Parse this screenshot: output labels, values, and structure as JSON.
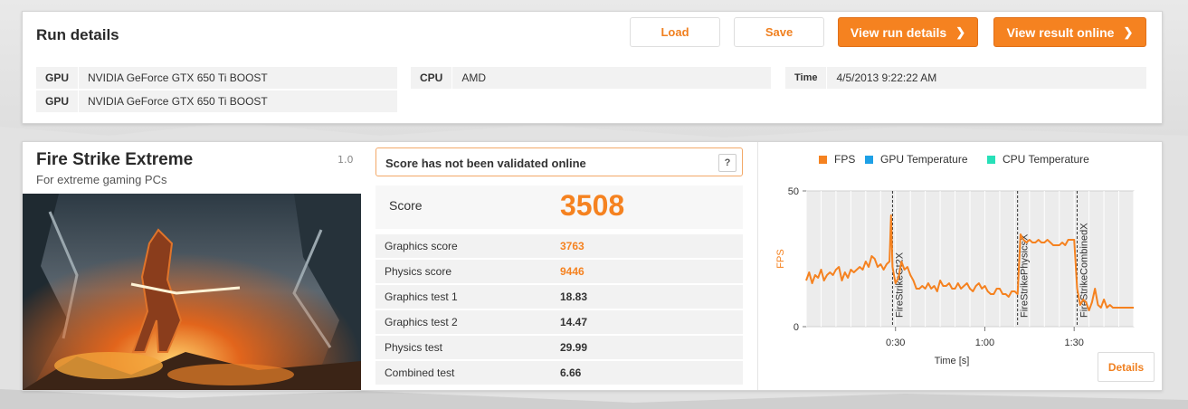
{
  "run_details": {
    "title": "Run details",
    "buttons": {
      "load": "Load",
      "save": "Save",
      "view_run_details": "View run details",
      "view_result_online": "View result online"
    },
    "gpu": [
      {
        "label": "GPU",
        "value": "NVIDIA GeForce GTX 650 Ti BOOST"
      },
      {
        "label": "GPU",
        "value": "NVIDIA GeForce GTX 650 Ti BOOST"
      }
    ],
    "cpu": {
      "label": "CPU",
      "value": "AMD"
    },
    "time": {
      "label": "Time",
      "value": "4/5/2013 9:22:22 AM"
    }
  },
  "test": {
    "name": "Fire Strike Extreme",
    "subtitle": "For extreme gaming PCs",
    "version": "1.0",
    "validation_message": "Score has not been validated online",
    "help_label": "?",
    "score_label": "Score",
    "score_value": "3508",
    "rows": [
      {
        "label": "Graphics score",
        "value": "3763",
        "accent": true
      },
      {
        "label": "Physics score",
        "value": "9446",
        "accent": true
      },
      {
        "label": "Graphics test 1",
        "value": "18.83",
        "accent": false
      },
      {
        "label": "Graphics test 2",
        "value": "14.47",
        "accent": false
      },
      {
        "label": "Physics test",
        "value": "29.99",
        "accent": false
      },
      {
        "label": "Combined test",
        "value": "6.66",
        "accent": false
      }
    ],
    "details_label": "Details"
  },
  "colors": {
    "accent": "#f58220",
    "gpu_temp": "#1ea0e6",
    "cpu_temp": "#27e0b8"
  },
  "chart_data": {
    "type": "line",
    "legend": [
      {
        "name": "FPS",
        "color": "#f58220"
      },
      {
        "name": "GPU Temperature",
        "color": "#1ea0e6"
      },
      {
        "name": "CPU Temperature",
        "color": "#27e0b8"
      }
    ],
    "ylabel": "FPS",
    "xlabel": "Time [s]",
    "x_ticks": [
      "0:30",
      "1:00",
      "1:30"
    ],
    "x_tick_values": [
      30,
      60,
      90
    ],
    "y_ticks": [
      0,
      50
    ],
    "xlim": [
      0,
      110
    ],
    "ylim": [
      0,
      50
    ],
    "grid": true,
    "markers": [
      {
        "label": "FireStrikeGt2X",
        "x": 29
      },
      {
        "label": "FireStrikePhysicsX",
        "x": 71
      },
      {
        "label": "FireStrikeCombinedX",
        "x": 91
      }
    ],
    "series": [
      {
        "name": "FPS",
        "points": [
          [
            0,
            17
          ],
          [
            1,
            20
          ],
          [
            2,
            16
          ],
          [
            3,
            19
          ],
          [
            4,
            18
          ],
          [
            5,
            21
          ],
          [
            6,
            17
          ],
          [
            7,
            19
          ],
          [
            8,
            20
          ],
          [
            9,
            19
          ],
          [
            10,
            21
          ],
          [
            11,
            22
          ],
          [
            12,
            17
          ],
          [
            13,
            20
          ],
          [
            14,
            18
          ],
          [
            15,
            21
          ],
          [
            16,
            20
          ],
          [
            17,
            21
          ],
          [
            18,
            22
          ],
          [
            19,
            21
          ],
          [
            20,
            24
          ],
          [
            21,
            22
          ],
          [
            22,
            26
          ],
          [
            23,
            25
          ],
          [
            24,
            22
          ],
          [
            25,
            23
          ],
          [
            26,
            21
          ],
          [
            27,
            23
          ],
          [
            28,
            24
          ],
          [
            28.5,
            41
          ],
          [
            29,
            22
          ],
          [
            30,
            16
          ],
          [
            31,
            18
          ],
          [
            32,
            24
          ],
          [
            33,
            21
          ],
          [
            34,
            22
          ],
          [
            35,
            19
          ],
          [
            36,
            17
          ],
          [
            37,
            14
          ],
          [
            38,
            14
          ],
          [
            39,
            15
          ],
          [
            40,
            14
          ],
          [
            41,
            16
          ],
          [
            42,
            14
          ],
          [
            43,
            15
          ],
          [
            44,
            13
          ],
          [
            45,
            17
          ],
          [
            46,
            15
          ],
          [
            47,
            15
          ],
          [
            48,
            16
          ],
          [
            49,
            14
          ],
          [
            50,
            14
          ],
          [
            51,
            16
          ],
          [
            52,
            14
          ],
          [
            53,
            15
          ],
          [
            54,
            16
          ],
          [
            55,
            14
          ],
          [
            56,
            13
          ],
          [
            57,
            15
          ],
          [
            58,
            16
          ],
          [
            59,
            14
          ],
          [
            60,
            15
          ],
          [
            61,
            13
          ],
          [
            62,
            12
          ],
          [
            63,
            12
          ],
          [
            64,
            14
          ],
          [
            65,
            14
          ],
          [
            66,
            12
          ],
          [
            67,
            12
          ],
          [
            68,
            11
          ],
          [
            69,
            13
          ],
          [
            70,
            13
          ],
          [
            71,
            12
          ],
          [
            72,
            34
          ],
          [
            73,
            32
          ],
          [
            74,
            31
          ],
          [
            75,
            32
          ],
          [
            76,
            31
          ],
          [
            77,
            31
          ],
          [
            78,
            32
          ],
          [
            79,
            31
          ],
          [
            80,
            31
          ],
          [
            81,
            32
          ],
          [
            82,
            31
          ],
          [
            83,
            30
          ],
          [
            84,
            30
          ],
          [
            85,
            30
          ],
          [
            86,
            31
          ],
          [
            87,
            30
          ],
          [
            88,
            32
          ],
          [
            89,
            32
          ],
          [
            90,
            32
          ],
          [
            91,
            14
          ],
          [
            92,
            8
          ],
          [
            93,
            10
          ],
          [
            94,
            9
          ],
          [
            95,
            6
          ],
          [
            96,
            9
          ],
          [
            97,
            14
          ],
          [
            98,
            8
          ],
          [
            99,
            7
          ],
          [
            100,
            10
          ],
          [
            101,
            7
          ],
          [
            102,
            8
          ],
          [
            103,
            7
          ],
          [
            104,
            7
          ],
          [
            105,
            7
          ],
          [
            106,
            7
          ],
          [
            107,
            7
          ],
          [
            108,
            7
          ],
          [
            109,
            7
          ],
          [
            110,
            7
          ]
        ]
      }
    ]
  }
}
